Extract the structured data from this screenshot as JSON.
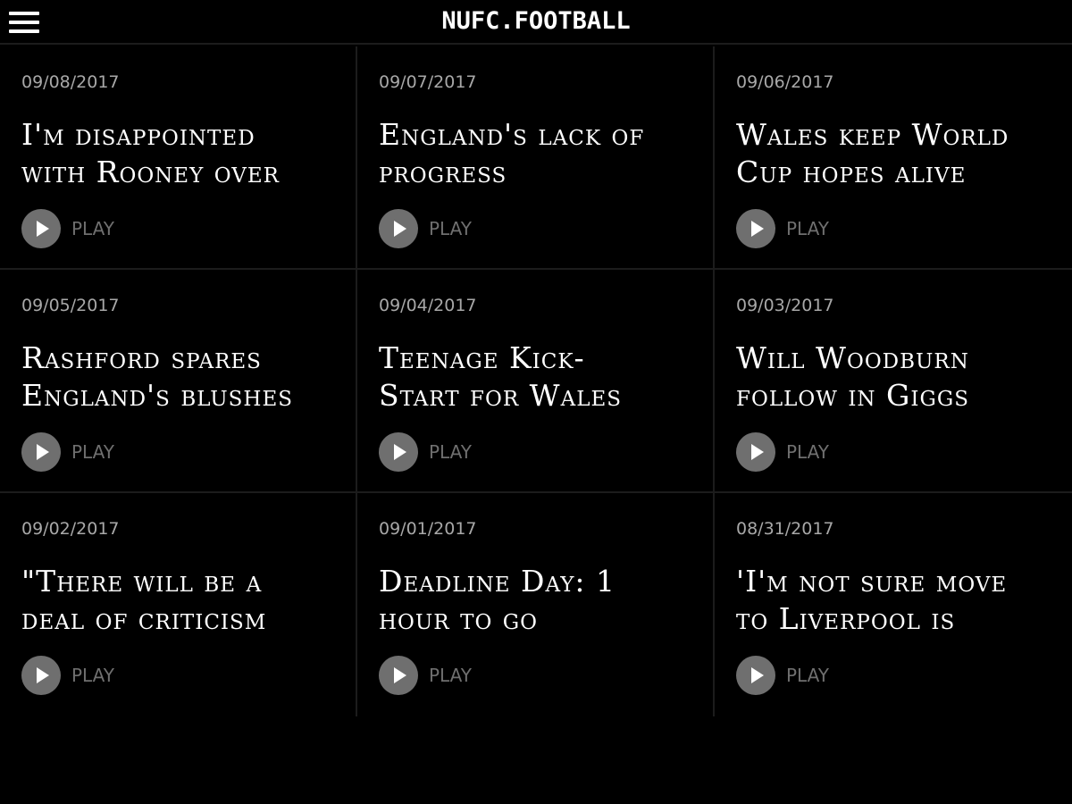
{
  "header": {
    "title": "NUFC.FOOTBALL",
    "menu_icon": "hamburger-menu-icon"
  },
  "colors": {
    "background": "#000000",
    "divider": "#1c1c1c",
    "date_text": "#a8a8a8",
    "play_gray": "#6f6f6f",
    "headline_text": "#ffffff"
  },
  "play_label": "PLAY",
  "articles": [
    {
      "date": "09/08/2017",
      "headline_1": "I'm disappointed",
      "headline_2": "with Rooney over"
    },
    {
      "date": "09/07/2017",
      "headline_1": "England's lack of",
      "headline_2": "progress"
    },
    {
      "date": "09/06/2017",
      "headline_1": "Wales keep World",
      "headline_2": "Cup hopes alive"
    },
    {
      "date": "09/05/2017",
      "headline_1": "Rashford spares",
      "headline_2": "England's blushes"
    },
    {
      "date": "09/04/2017",
      "headline_1": "Teenage Kick-",
      "headline_2": "Start for Wales"
    },
    {
      "date": "09/03/2017",
      "headline_1": "Will Woodburn",
      "headline_2": "follow in Giggs"
    },
    {
      "date": "09/02/2017",
      "headline_1": "\"There will be a",
      "headline_2": "deal of criticism"
    },
    {
      "date": "09/01/2017",
      "headline_1": "Deadline Day: 1",
      "headline_2": "hour to go"
    },
    {
      "date": "08/31/2017",
      "headline_1": "'I'm not sure move",
      "headline_2": "to Liverpool is"
    }
  ]
}
